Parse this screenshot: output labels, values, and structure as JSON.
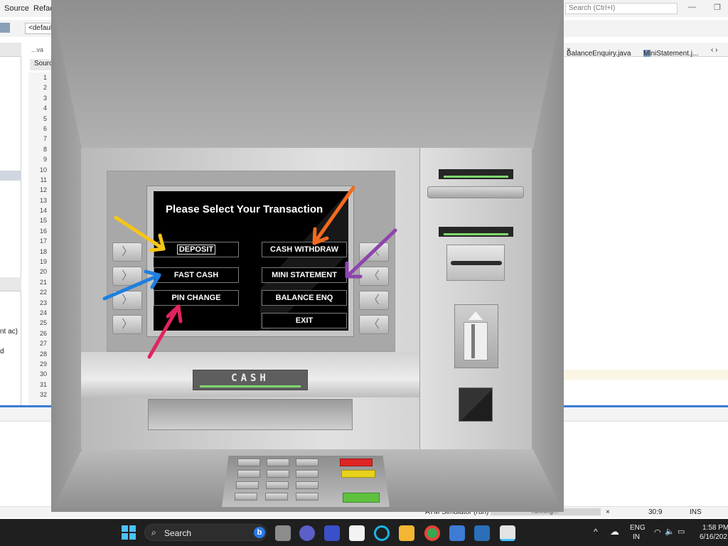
{
  "ide": {
    "menu": [
      "Source",
      "Refac"
    ],
    "search_placeholder": "Search (Ctrl+I)",
    "toolbar_combo": "<default",
    "editor_tab": "...va",
    "source_tab": "Source",
    "line_numbers": [
      "1",
      "2",
      "3",
      "4",
      "5",
      "6",
      "7",
      "8",
      "9",
      "10",
      "11",
      "12",
      "13",
      "14",
      "15",
      "16",
      "17",
      "18",
      "19",
      "20",
      "21",
      "22",
      "23",
      "24",
      "25",
      "26",
      "27",
      "28",
      "29",
      "30",
      "31",
      "32"
    ],
    "left_panel_text_1": "nt ac)",
    "left_panel_text_2": "d",
    "right_tabs": [
      "BalanceEnquiry.java",
      "MiniStatement.j..."
    ],
    "status": {
      "run_label": "ATM Simulator (run)",
      "progress_label": "running...",
      "position": "30:9",
      "mode": "INS"
    }
  },
  "atm": {
    "screen_title": "Please Select Your Transaction",
    "buttons": {
      "deposit": "DEPOSIT",
      "cash_withdraw": "CASH WITHDRAW",
      "fast_cash": "FAST CASH",
      "mini_statement": "MINI STATEMENT",
      "pin_change": "PIN CHANGE",
      "balance_enq": "BALANCE ENQ",
      "exit": "EXIT"
    },
    "cash_label": "CASH",
    "side_key_left_glyph": "〉",
    "side_key_right_glyph": "〈",
    "arrow_colors": [
      "#f5c518",
      "#f26b1d",
      "#1e7fe0",
      "#8e44ad",
      "#e0245e"
    ],
    "accent_green": "#7fd86d"
  },
  "taskbar": {
    "search_label": "Search",
    "bing_glyph": "b",
    "lang_1": "ENG",
    "lang_2": "IN",
    "time": "1:58 PM",
    "date": "6/16/202"
  }
}
